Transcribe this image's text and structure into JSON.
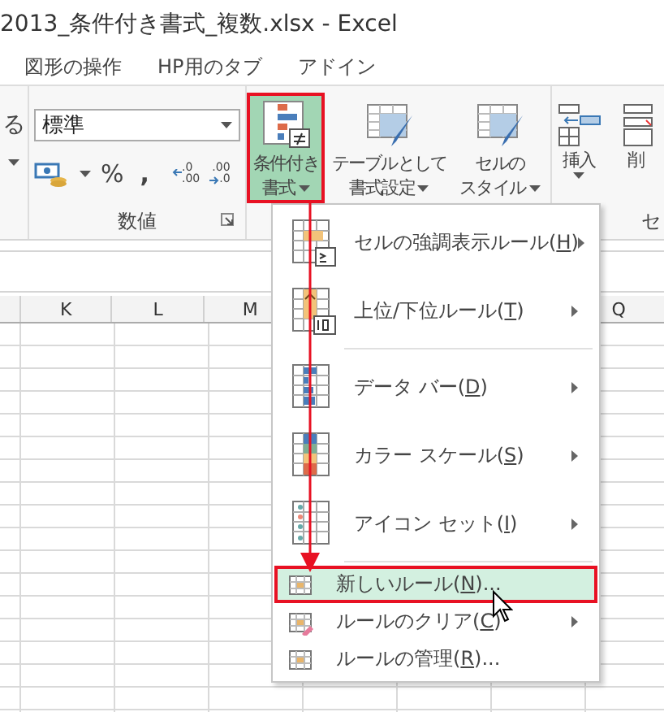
{
  "window": {
    "title": "2013_条件付き書式_複数.xlsx - Excel"
  },
  "ribbon_tabs": [
    {
      "label": "図形の操作",
      "selected": false
    },
    {
      "label": "HP用のタブ",
      "selected": false
    },
    {
      "label": "アドイン",
      "selected": false
    }
  ],
  "ribbon": {
    "left_partial": {
      "label": "る"
    },
    "number_group": {
      "format_field": {
        "value": "標準"
      },
      "percent": "%",
      "comma": ",",
      "increase_decimal": {
        "top": ".0",
        "bottom": ".00"
      },
      "decrease_decimal": {
        "top": ".00",
        "bottom": ".0"
      },
      "label": "数値"
    },
    "styles_group": [
      {
        "label_lines": [
          "条件付き",
          "書式"
        ],
        "selected": true
      },
      {
        "label_lines": [
          "テーブルとして",
          "書式設定"
        ],
        "selected": false
      },
      {
        "label_lines": [
          "セルの",
          "スタイル"
        ],
        "selected": false
      }
    ],
    "cells_group": {
      "insert": {
        "label": "挿入"
      },
      "delete_partial": {
        "label": "削"
      },
      "label": "セ"
    }
  },
  "sheet": {
    "column_headers": [
      "K",
      "L",
      "M",
      "Q"
    ]
  },
  "menu": {
    "items": [
      {
        "kind": "large",
        "before": "セルの強調表示ルール(",
        "key": "H",
        "after": ")",
        "submenu": true,
        "selected": false
      },
      {
        "kind": "large",
        "before": "上位/下位ルール(",
        "key": "T",
        "after": ")",
        "submenu": true,
        "selected": false
      },
      {
        "kind": "separator"
      },
      {
        "kind": "large",
        "before": "データ バー(",
        "key": "D",
        "after": ")",
        "submenu": true,
        "selected": false
      },
      {
        "kind": "large",
        "before": "カラー スケール(",
        "key": "S",
        "after": ")",
        "submenu": true,
        "selected": false
      },
      {
        "kind": "large",
        "before": "アイコン セット(",
        "key": "I",
        "after": ")",
        "submenu": true,
        "selected": false
      },
      {
        "kind": "separator"
      },
      {
        "kind": "small",
        "before": "新しいルール(",
        "key": "N",
        "after": ")...",
        "submenu": false,
        "selected": true
      },
      {
        "kind": "small",
        "before": "ルールのクリア(",
        "key": "C",
        "after": ")",
        "submenu": true,
        "selected": false
      },
      {
        "kind": "small",
        "before": "ルールの管理(",
        "key": "R",
        "after": ")...",
        "submenu": false,
        "selected": false
      }
    ]
  }
}
